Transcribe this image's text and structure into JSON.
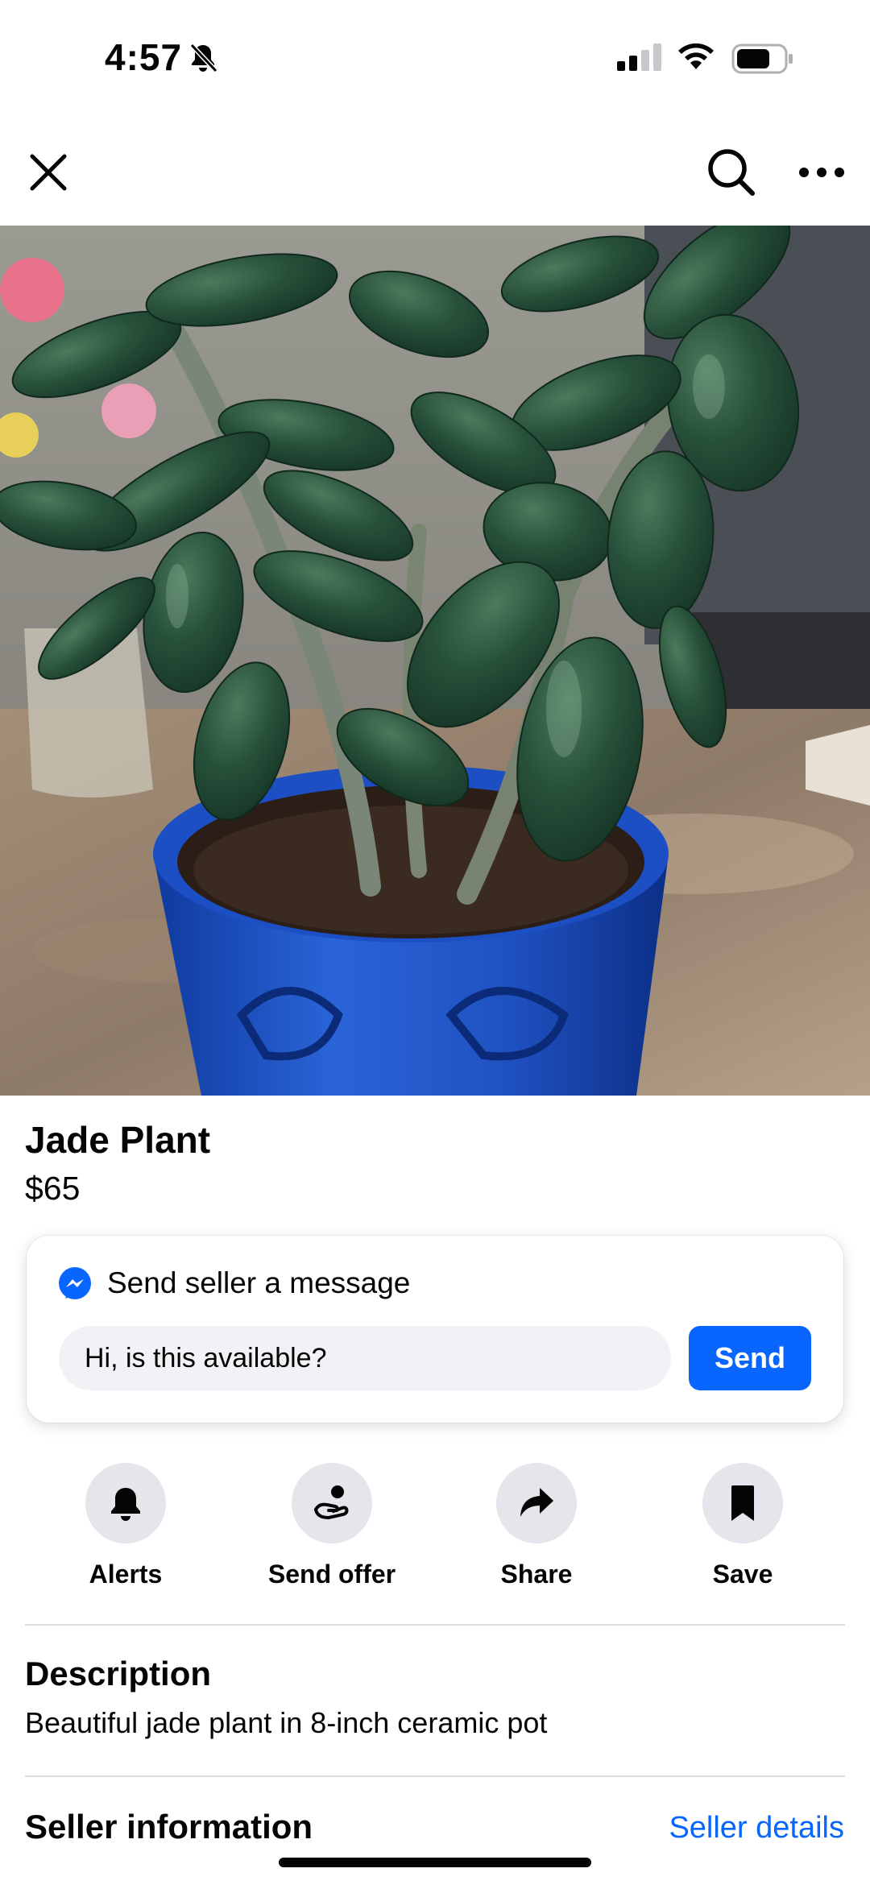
{
  "status_bar": {
    "time": "4:57"
  },
  "listing": {
    "title": "Jade Plant",
    "price": "$65"
  },
  "message_card": {
    "heading": "Send seller a message",
    "input_value": "Hi, is this available?",
    "send_label": "Send"
  },
  "actions": [
    {
      "label": "Alerts",
      "icon": "bell-icon"
    },
    {
      "label": "Send offer",
      "icon": "offer-icon"
    },
    {
      "label": "Share",
      "icon": "share-icon"
    },
    {
      "label": "Save",
      "icon": "bookmark-icon"
    }
  ],
  "description": {
    "heading": "Description",
    "text": "Beautiful jade plant in 8-inch ceramic pot"
  },
  "seller": {
    "heading": "Seller information",
    "link": "Seller details"
  },
  "colors": {
    "accent": "#0866ff",
    "chip_bg": "#e4e6eb",
    "input_bg": "#f0f2f5",
    "pot_blue": "#1f57c9"
  }
}
